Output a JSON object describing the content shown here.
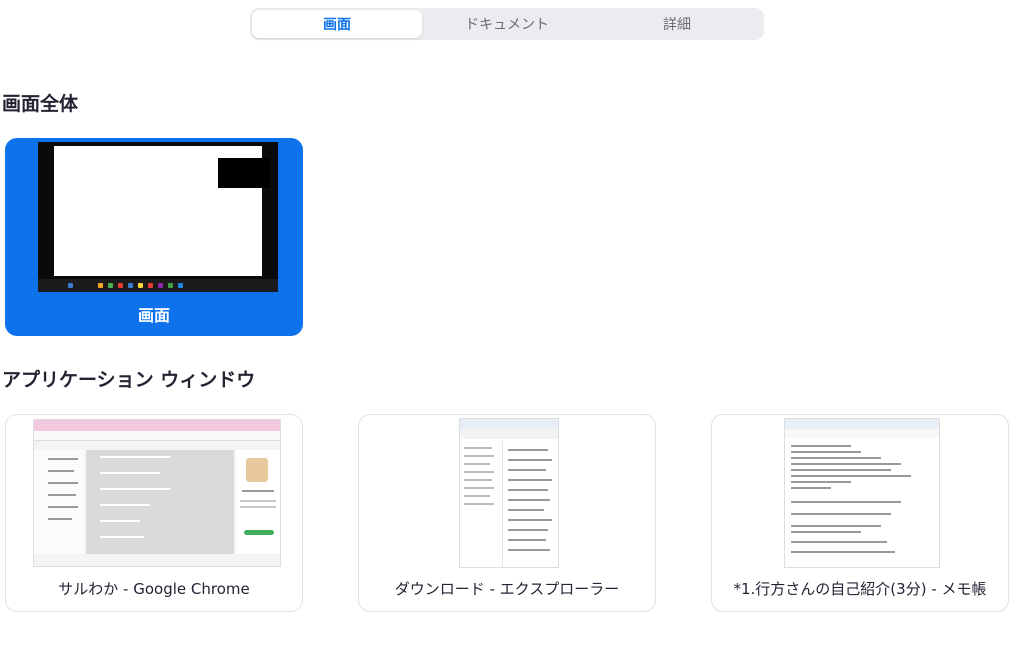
{
  "tabs": [
    {
      "label": "画面",
      "active": true
    },
    {
      "label": "ドキュメント",
      "active": false
    },
    {
      "label": "詳細",
      "active": false
    }
  ],
  "sections": {
    "fullscreen_title": "画面全体",
    "apps_title": "アプリケーション ウィンドウ"
  },
  "screen_card": {
    "label": "画面",
    "selected": true
  },
  "app_cards": [
    {
      "label": "サルわか - Google Chrome"
    },
    {
      "label": "ダウンロード - エクスプローラー"
    },
    {
      "label": "*1.行方さんの自己紹介(3分) - メモ帳"
    }
  ],
  "colors": {
    "accent": "#0e72ed"
  }
}
